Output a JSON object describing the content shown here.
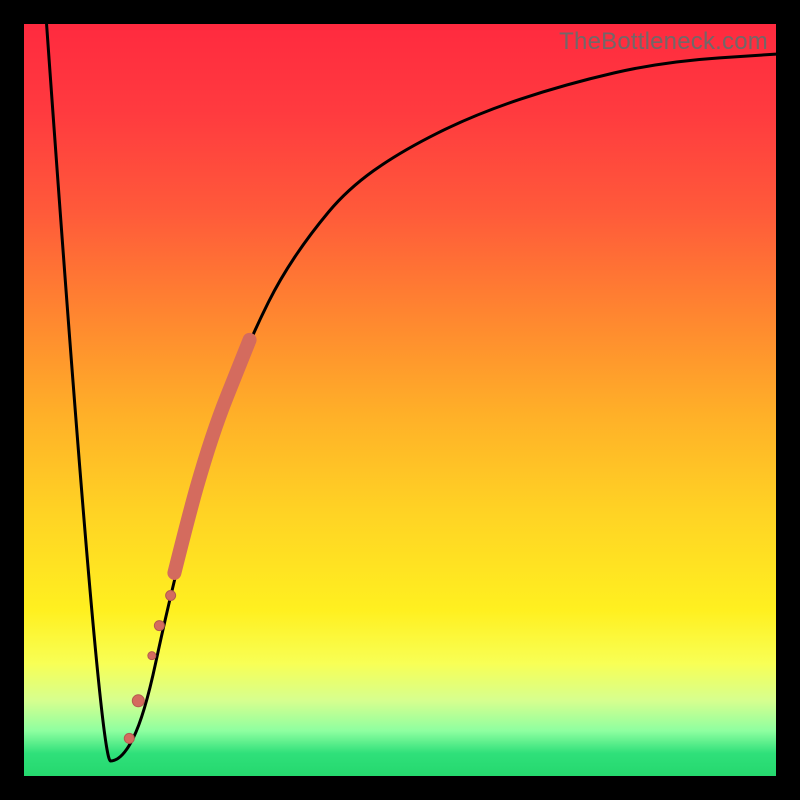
{
  "watermark": {
    "text": "TheBottleneck.com"
  },
  "colors": {
    "curve_stroke": "#000000",
    "marker_fill": "#d46b5e",
    "marker_stroke": "#b35a50",
    "gradient_stops": [
      "#ff2a3f",
      "#ff3b3f",
      "#ff5a3a",
      "#ff8a2f",
      "#ffb028",
      "#ffd324",
      "#fff020",
      "#f8ff55",
      "#d6ff8f",
      "#8effa0",
      "#2fe07a",
      "#25d86e"
    ]
  },
  "chart_data": {
    "type": "line",
    "title": "",
    "xlabel": "",
    "ylabel": "",
    "xlim": [
      0,
      100
    ],
    "ylim": [
      0,
      100
    ],
    "grid": false,
    "series": [
      {
        "name": "bottleneck-curve",
        "x": [
          3,
          10,
          13,
          16,
          19,
          22,
          25,
          28,
          31,
          34,
          38,
          43,
          50,
          60,
          72,
          85,
          100
        ],
        "y": [
          100,
          2,
          2,
          8,
          22,
          34,
          44,
          53,
          60,
          66,
          72,
          78,
          83,
          88,
          92,
          95,
          96
        ]
      }
    ],
    "markers": [
      {
        "name": "dot1",
        "x": 14.0,
        "y": 5,
        "r": 5
      },
      {
        "name": "dot2",
        "x": 15.2,
        "y": 10,
        "r": 6
      },
      {
        "name": "dot3",
        "x": 17.0,
        "y": 16,
        "r": 4
      },
      {
        "name": "dot4",
        "x": 18.0,
        "y": 20,
        "r": 5
      },
      {
        "name": "dot5",
        "x": 19.5,
        "y": 24,
        "r": 5
      }
    ],
    "thick_segment": {
      "name": "thick-curve-segment",
      "x": [
        20,
        22,
        24,
        26,
        28,
        30
      ],
      "y": [
        27,
        35,
        42,
        48,
        53,
        58
      ],
      "width": 14
    }
  }
}
